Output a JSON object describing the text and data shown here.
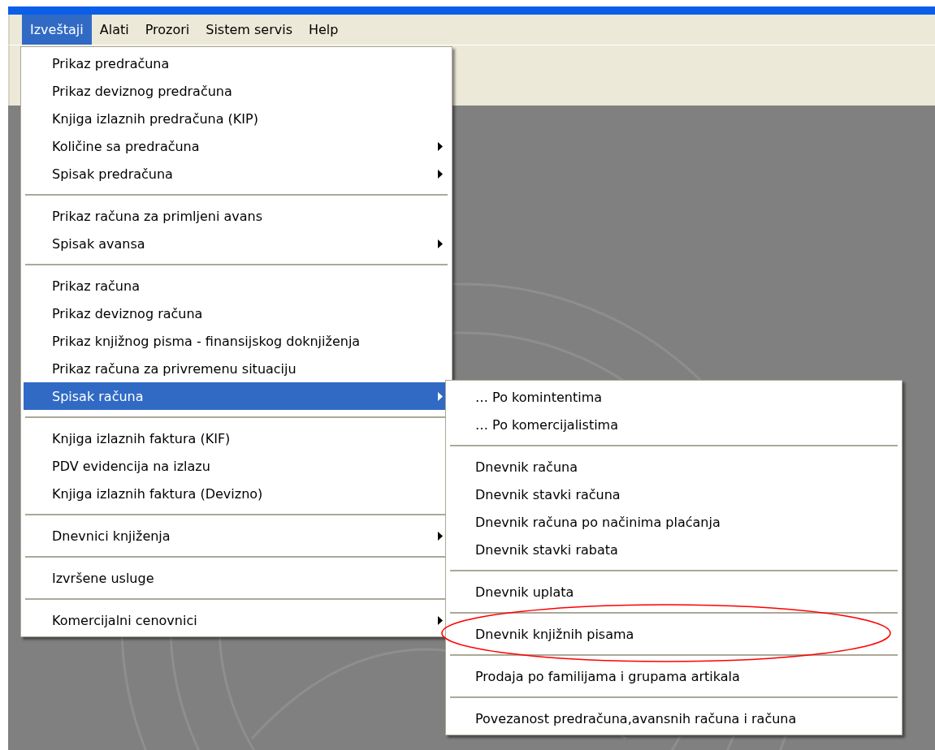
{
  "menubar": [
    {
      "label": "Izveštaji",
      "selected": true
    },
    {
      "label": "Alati",
      "selected": false
    },
    {
      "label": "Prozori",
      "selected": false
    },
    {
      "label": "Sistem servis",
      "selected": false
    },
    {
      "label": "Help",
      "selected": false
    }
  ],
  "menu": [
    {
      "kind": "item",
      "label": "Prikaz predračuna",
      "submenu": false,
      "selected": false
    },
    {
      "kind": "item",
      "label": "Prikaz deviznog predračuna",
      "submenu": false,
      "selected": false
    },
    {
      "kind": "item",
      "label": "Knjiga izlaznih predračuna (KIP)",
      "submenu": false,
      "selected": false
    },
    {
      "kind": "item",
      "label": "Količine sa predračuna",
      "submenu": true,
      "selected": false
    },
    {
      "kind": "item",
      "label": "Spisak predračuna",
      "submenu": true,
      "selected": false
    },
    {
      "kind": "separator"
    },
    {
      "kind": "item",
      "label": "Prikaz računa za primljeni avans",
      "submenu": false,
      "selected": false
    },
    {
      "kind": "item",
      "label": "Spisak avansa",
      "submenu": true,
      "selected": false
    },
    {
      "kind": "separator"
    },
    {
      "kind": "item",
      "label": "Prikaz računa",
      "submenu": false,
      "selected": false
    },
    {
      "kind": "item",
      "label": "Prikaz deviznog računa",
      "submenu": false,
      "selected": false
    },
    {
      "kind": "item",
      "label": "Prikaz knjižnog pisma - finansijskog doknjiženja",
      "submenu": false,
      "selected": false
    },
    {
      "kind": "item",
      "label": "Prikaz računa za privremenu situaciju",
      "submenu": false,
      "selected": false
    },
    {
      "kind": "item",
      "label": "Spisak računa",
      "submenu": true,
      "selected": true
    },
    {
      "kind": "separator"
    },
    {
      "kind": "item",
      "label": "Knjiga izlaznih faktura (KIF)",
      "submenu": false,
      "selected": false
    },
    {
      "kind": "item",
      "label": "PDV evidencija na izlazu",
      "submenu": false,
      "selected": false
    },
    {
      "kind": "item",
      "label": "Knjiga izlaznih faktura (Devizno)",
      "submenu": false,
      "selected": false
    },
    {
      "kind": "separator"
    },
    {
      "kind": "item",
      "label": "Dnevnici knjiženja",
      "submenu": true,
      "selected": false
    },
    {
      "kind": "separator"
    },
    {
      "kind": "item",
      "label": "Izvršene usluge",
      "submenu": false,
      "selected": false
    },
    {
      "kind": "separator"
    },
    {
      "kind": "item",
      "label": "Komercijalni cenovnici",
      "submenu": true,
      "selected": false
    }
  ],
  "submenu": [
    {
      "kind": "item",
      "label": "… Po komintentima",
      "submenu": false,
      "selected": false
    },
    {
      "kind": "item",
      "label": "… Po komercijalistima",
      "submenu": false,
      "selected": false
    },
    {
      "kind": "separator"
    },
    {
      "kind": "item",
      "label": "Dnevnik računa",
      "submenu": false,
      "selected": false
    },
    {
      "kind": "item",
      "label": "Dnevnik stavki računa",
      "submenu": false,
      "selected": false
    },
    {
      "kind": "item",
      "label": "Dnevnik računa po načinima plaćanja",
      "submenu": false,
      "selected": false
    },
    {
      "kind": "item",
      "label": "Dnevnik stavki rabata",
      "submenu": false,
      "selected": false
    },
    {
      "kind": "separator"
    },
    {
      "kind": "item",
      "label": "Dnevnik uplata",
      "submenu": false,
      "selected": false
    },
    {
      "kind": "separator"
    },
    {
      "kind": "item",
      "label": "Dnevnik knjižnih pisama",
      "submenu": false,
      "selected": false
    },
    {
      "kind": "separator"
    },
    {
      "kind": "item",
      "label": "Prodaja po familijama i grupama artikala",
      "submenu": false,
      "selected": false
    },
    {
      "kind": "separator"
    },
    {
      "kind": "item",
      "label": "Povezanost predračuna,avansnih računa i računa",
      "submenu": false,
      "selected": false
    }
  ]
}
